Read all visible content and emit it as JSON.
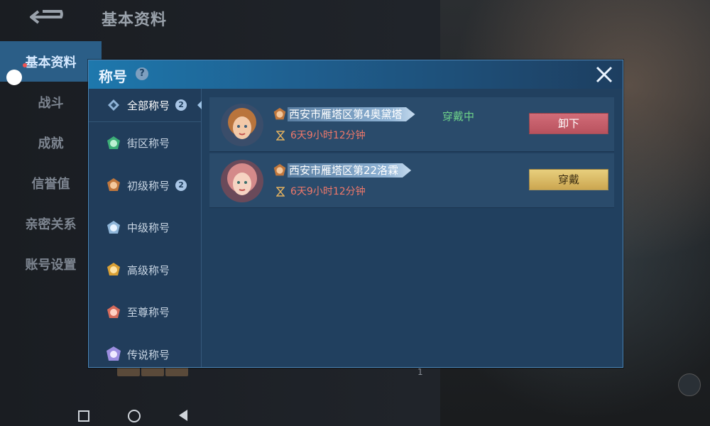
{
  "page": {
    "title": "基本资料"
  },
  "left_menu": [
    {
      "label": "基本资料",
      "active": true
    },
    {
      "label": "战斗",
      "active": false
    },
    {
      "label": "成就",
      "active": false
    },
    {
      "label": "信誉值",
      "active": false
    },
    {
      "label": "亲密关系",
      "active": false
    },
    {
      "label": "账号设置",
      "active": false
    }
  ],
  "background": {
    "page_number": "1"
  },
  "modal": {
    "title": "称号",
    "help": "?",
    "categories": [
      {
        "label": "全部称号",
        "badge": "2",
        "active": true,
        "icon": "diamond-icon"
      },
      {
        "label": "街区称号",
        "badge": "",
        "active": false,
        "icon": "green-medal-icon"
      },
      {
        "label": "初级称号",
        "badge": "2",
        "active": false,
        "icon": "bronze-medal-icon"
      },
      {
        "label": "中级称号",
        "badge": "",
        "active": false,
        "icon": "silver-medal-icon"
      },
      {
        "label": "高级称号",
        "badge": "",
        "active": false,
        "icon": "gold-medal-icon"
      },
      {
        "label": "至尊称号",
        "badge": "",
        "active": false,
        "icon": "red-medal-icon"
      },
      {
        "label": "传说称号",
        "badge": "",
        "active": false,
        "icon": "legend-medal-icon"
      }
    ],
    "titles": [
      {
        "name": "西安市雁塔区第4奥黛塔",
        "time": "6天9小时12分钟",
        "status": "穿戴中",
        "button": "卸下",
        "button_type": "unequip"
      },
      {
        "name": "西安市雁塔区第22洛霖",
        "time": "6天9小时12分钟",
        "status": "",
        "button": "穿戴",
        "button_type": "equip"
      }
    ]
  },
  "colors": {
    "accent_blue": "#1e78ad",
    "equip_gold": "#cba650",
    "unequip_red": "#b8525e",
    "active_green": "#6ed28a",
    "time_red": "#f0786a"
  }
}
